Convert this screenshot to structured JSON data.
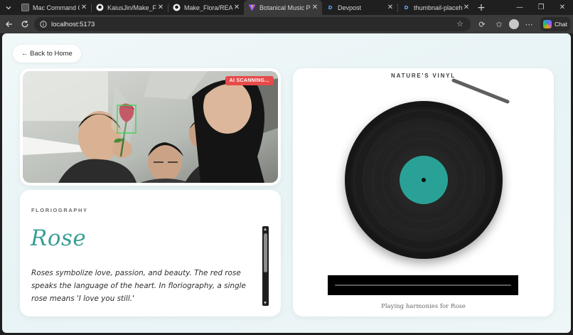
{
  "browser": {
    "tabs": [
      {
        "title": "Mac Command Cont",
        "icon": "app-icon",
        "active": false
      },
      {
        "title": "KaiusJin/Make_Flora",
        "icon": "github-icon",
        "active": false
      },
      {
        "title": "Make_Flora/READMI",
        "icon": "github-icon",
        "active": false
      },
      {
        "title": "Botanical Music Play",
        "icon": "vite-icon",
        "active": true
      },
      {
        "title": "Devpost",
        "icon": "devpost-icon",
        "active": false
      },
      {
        "title": "thumbnail-placehold",
        "icon": "devpost-icon",
        "active": false
      }
    ],
    "url": "localhost:5173",
    "chat_label": "Chat"
  },
  "page": {
    "back_label": "← Back to Home",
    "scan_badge": "AI SCANNING...",
    "section_label": "FLORIOGRAPHY",
    "flower_name": "Rose",
    "meaning": "Roses symbolize love, passion, and beauty. The red rose speaks the language of the heart. In floriography, a single rose means 'I love you still.'",
    "player_title": "NATURE'S VINYL",
    "caption": "Playing harmonies for Rose",
    "colors": {
      "accent": "#3a9f95",
      "record_label": "#2aa196",
      "scan_badge": "#e84a4a",
      "detection_box": "#39d353"
    }
  }
}
